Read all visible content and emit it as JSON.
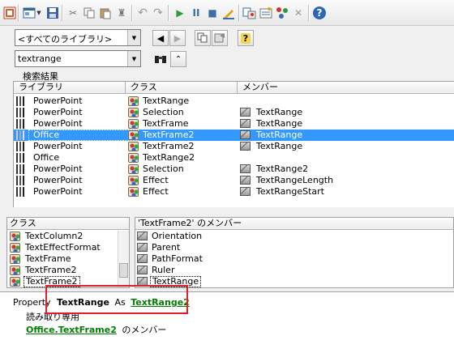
{
  "colors": {
    "selection": "#3399ff",
    "link": "#008000",
    "highlight_box": "#e0202a"
  },
  "toolbar": {
    "icons": [
      "excel-icon",
      "add-module-icon",
      "dropdown-arrow",
      "save-icon",
      "cut-icon",
      "copy-icon",
      "paste-icon",
      "find-icon",
      "undo-icon",
      "redo-icon",
      "run-icon",
      "pause-icon",
      "stop-icon",
      "design-mode-icon",
      "project-explorer-icon",
      "properties-icon",
      "object-browser-icon",
      "toolbox-icon",
      "help-icon"
    ]
  },
  "library_combo": {
    "value": "<すべてのライブラリ>"
  },
  "search_combo": {
    "value": "textrange"
  },
  "results": {
    "label": "検索結果",
    "columns": [
      "ライブラリ",
      "クラス",
      "メンバー"
    ],
    "rows": [
      {
        "library": "PowerPoint",
        "class": "TextRange",
        "member": ""
      },
      {
        "library": "PowerPoint",
        "class": "Selection",
        "member": "TextRange"
      },
      {
        "library": "PowerPoint",
        "class": "TextFrame",
        "member": "TextRange"
      },
      {
        "library": "Office",
        "class": "TextFrame2",
        "member": "TextRange"
      },
      {
        "library": "PowerPoint",
        "class": "TextFrame2",
        "member": "TextRange"
      },
      {
        "library": "Office",
        "class": "TextRange2",
        "member": ""
      },
      {
        "library": "PowerPoint",
        "class": "Selection",
        "member": "TextRange2"
      },
      {
        "library": "PowerPoint",
        "class": "Effect",
        "member": "TextRangeLength"
      },
      {
        "library": "PowerPoint",
        "class": "Effect",
        "member": "TextRangeStart"
      }
    ]
  },
  "class_pane": {
    "header": "クラス",
    "items": [
      "TextColumn2",
      "TextEffectFormat",
      "TextFrame",
      "TextFrame2",
      "TextFrame2"
    ]
  },
  "member_pane": {
    "header": "'TextFrame2' のメンバー",
    "items": [
      "Orientation",
      "Parent",
      "PathFormat",
      "Ruler",
      "TextRange"
    ]
  },
  "details": {
    "kind": "Property",
    "name": "TextRange",
    "as": "As",
    "type": "TextRange2",
    "access": "読み取り専用",
    "owner_lib": "Office",
    "owner_sep": ".",
    "owner_class": "TextFrame2",
    "owner_suffix": "のメンバー"
  }
}
